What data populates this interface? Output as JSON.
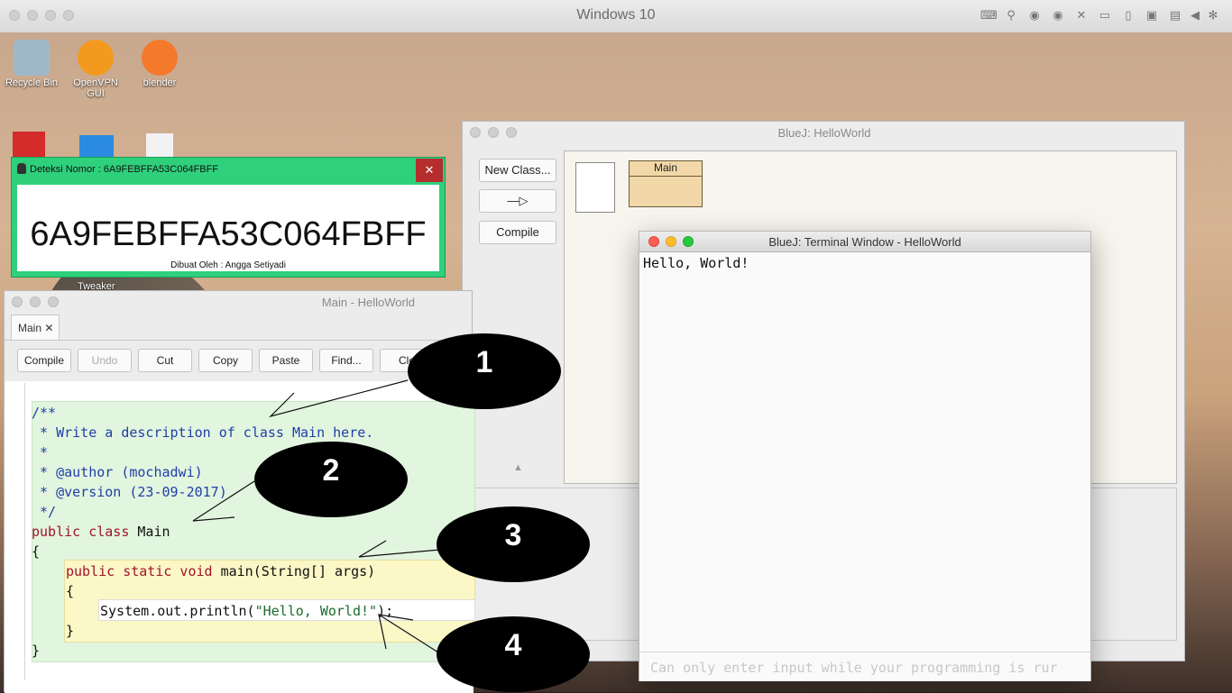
{
  "host": {
    "title": "Windows 10",
    "status_icons": [
      "keyboard-icon",
      "usb-icon",
      "disc-icon",
      "disc-icon",
      "camera-icon",
      "tablet-icon",
      "folder-share-icon",
      "screen-icon",
      "arrow-left-icon",
      "gear-icon"
    ]
  },
  "desktop": {
    "icons": [
      {
        "label": "Recycle Bin",
        "color": "#9fb8c9"
      },
      {
        "label": "OpenVPN GUI",
        "color": "#f39a1e"
      },
      {
        "label": "blender",
        "color": "#f5792a"
      }
    ],
    "tweaker_label": "Tweaker"
  },
  "detector": {
    "title": "Deteksi Nomor : 6A9FEBFFA53C064FBFF",
    "close": "✕",
    "code": "6A9FEBFFA53C064FBFF",
    "credit": "Dibuat Oleh : Angga Setiyadi"
  },
  "editor": {
    "title": "Main - HelloWorld",
    "tab": "Main ✕",
    "toolbar": [
      "Compile",
      "Undo",
      "Cut",
      "Copy",
      "Paste",
      "Find...",
      "Clo"
    ],
    "code": {
      "l1": "/**",
      "l2": " * Write a description of class Main here.",
      "l3": " *",
      "l4": " * @author (mochadwi)",
      "l5": " * @version (23-09-2017)",
      "l6": " */",
      "l7_kw": "public class",
      "l7_name": " Main",
      "l8": "{",
      "l9_kw": "public static void",
      "l9_rest": " main(String[] args)",
      "l10": "{",
      "l11_a": "System.out.println(",
      "l11_str": "\"Hello, World!\"",
      "l11_b": ");",
      "l12": "}",
      "l13": "}"
    }
  },
  "bluej": {
    "title": "BlueJ:  HelloWorld",
    "new_class": "New Class...",
    "arrow": "—▷",
    "compile": "Compile",
    "class_name": "Main",
    "up_arrow": "▲"
  },
  "terminal": {
    "title": "BlueJ: Terminal Window - HelloWorld",
    "output": "Hello, World!",
    "input_placeholder": "Can only enter input while your programming is rur"
  },
  "annotations": [
    "1",
    "2",
    "3",
    "4"
  ],
  "colors": {
    "detector_green": "#2fd07c",
    "class_box": "#f2d8a8",
    "comment_blue": "#1f3fa8",
    "keyword_red": "#a0142d",
    "string_green": "#1c6b2c"
  }
}
